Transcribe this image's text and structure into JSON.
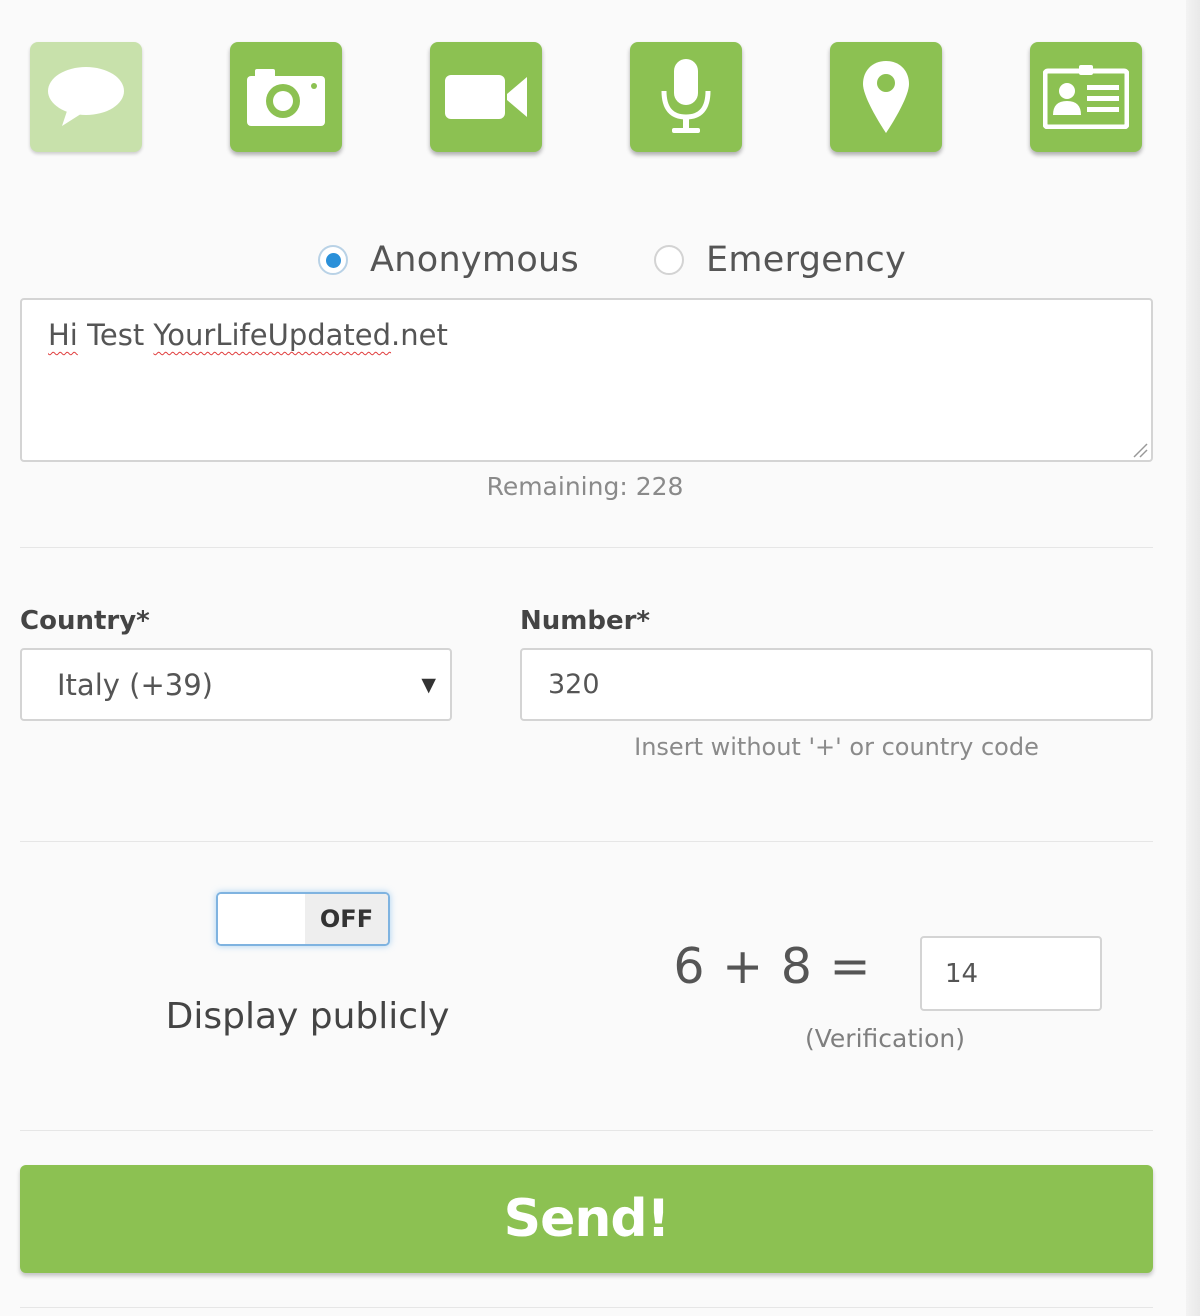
{
  "media_types": [
    {
      "icon": "speech-bubble-icon",
      "state": "selected"
    },
    {
      "icon": "camera-icon",
      "state": "default"
    },
    {
      "icon": "video-camera-icon",
      "state": "default"
    },
    {
      "icon": "microphone-icon",
      "state": "default"
    },
    {
      "icon": "location-pin-icon",
      "state": "default"
    },
    {
      "icon": "contact-card-icon",
      "state": "default"
    }
  ],
  "mode": {
    "anonymous_label": "Anonymous",
    "emergency_label": "Emergency",
    "selected": "Anonymous"
  },
  "message": {
    "value_prefix": "Hi",
    "value_mid": " Test ",
    "value_domain": "YourLifeUpdated",
    "value_suffix": ".net",
    "remaining": "Remaining: 228"
  },
  "country": {
    "label": "Country*",
    "selected": "Italy (+39)"
  },
  "number": {
    "label": "Number*",
    "value": "320",
    "hint": "Insert without '+' or country code"
  },
  "display_toggle": {
    "state": "OFF",
    "caption": "Display publicly"
  },
  "verification": {
    "equation": "6 + 8 =",
    "value": "14",
    "caption": "(Verification)"
  },
  "send": {
    "label": "Send!"
  },
  "colors": {
    "accent_green": "#8cc152",
    "selected_tile": "#c8e1ab",
    "radio_blue": "#2a90d9"
  }
}
